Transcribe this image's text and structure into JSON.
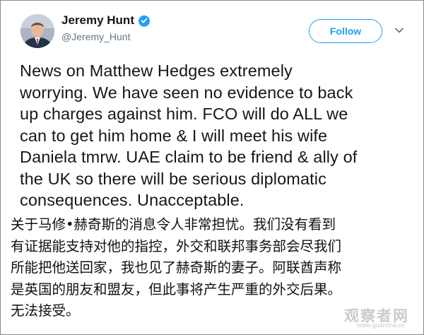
{
  "author": {
    "name": "Jeremy Hunt",
    "handle": "@Jeremy_Hunt",
    "verified_icon": "verified-badge-icon",
    "avatar_icon": "profile-photo"
  },
  "actions": {
    "follow_label": "Follow",
    "more_icon": "chevron-down-icon"
  },
  "tweet": {
    "lines": [
      "News on Matthew Hedges extremely",
      "worrying. We have seen no evidence to back",
      "up charges against him. FCO will do ALL we",
      "can to get him home & I will meet his wife",
      "Daniela tmrw. UAE claim to be friend & ally of",
      "the UK so there will be serious diplomatic",
      "consequences. Unacceptable."
    ]
  },
  "translation": {
    "lines": [
      "关于马修•赫奇斯的消息令人非常担忧。我们没有看到",
      "有证据能支持对他的指控，外交和联邦事务部会尽我们",
      "所能把他送回家，我也见了赫奇斯的妻子。阿联酋声称",
      "是英国的朋友和盟友，但此事将产生严重的外交后果。",
      "无法接受。"
    ]
  },
  "watermark": {
    "text": "观察者网",
    "sub": "www.guancha.cn"
  },
  "colors": {
    "accent": "#1da1f2",
    "text": "#14171a",
    "muted": "#657786"
  }
}
